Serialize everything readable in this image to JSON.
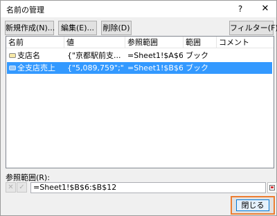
{
  "window": {
    "title": "名前の管理",
    "help": "?",
    "close": "✕"
  },
  "toolbar": {
    "new_label": "新規作成(N)...",
    "edit_label": "編集(E)...",
    "delete_label": "削除(D)",
    "filter_label": "フィルター(F)",
    "filter_arrow": "▾"
  },
  "table": {
    "headers": [
      "名前",
      "値",
      "参照範囲",
      "範囲",
      "コメント"
    ],
    "rows": [
      {
        "name": "支店名",
        "value": "{\"京都駅前支...",
        "ref": "=Sheet1!$A$6:$...",
        "scope": "ブック",
        "comment": "",
        "selected": false
      },
      {
        "name": "全支店売上",
        "value": "{\"5,089,759\";\"3,...",
        "ref": "=Sheet1!$B$6:$...",
        "scope": "ブック",
        "comment": "",
        "selected": true
      }
    ]
  },
  "reference": {
    "label": "参照範囲(R):",
    "cancel_symbol": "✕",
    "confirm_symbol": "✓",
    "value": "=Sheet1!$B$6:$B$12"
  },
  "footer": {
    "close_label": "閉じる"
  },
  "colors": {
    "selection": "#3399ff",
    "highlight_border": "#ed7d31"
  }
}
